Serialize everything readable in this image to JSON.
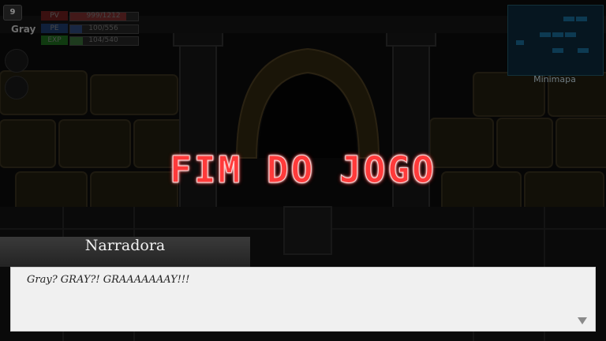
{
  "hud": {
    "level": "9",
    "player_name": "Gray",
    "stats": [
      {
        "label": "PV",
        "value": "999/1212",
        "fill": 0.82,
        "color": "#7a1f1f"
      },
      {
        "label": "PE",
        "value": "100/556",
        "fill": 0.18,
        "color": "#1f3f7a"
      },
      {
        "label": "EXP",
        "value": "104/540",
        "fill": 0.19,
        "color": "#2a6a2a"
      }
    ]
  },
  "minimap": {
    "label": "Minimapa"
  },
  "game_over": {
    "title": "FIM DO JOGO"
  },
  "dialogue": {
    "speaker": "Narradora",
    "text": "Gray? GRAY?! GRAAAAAAAY!!!"
  },
  "colors": {
    "game_over": "#ff3a3a",
    "dialogue_bg": "#f0f0f0"
  },
  "icons": {
    "advance": "triangle-down-icon"
  }
}
